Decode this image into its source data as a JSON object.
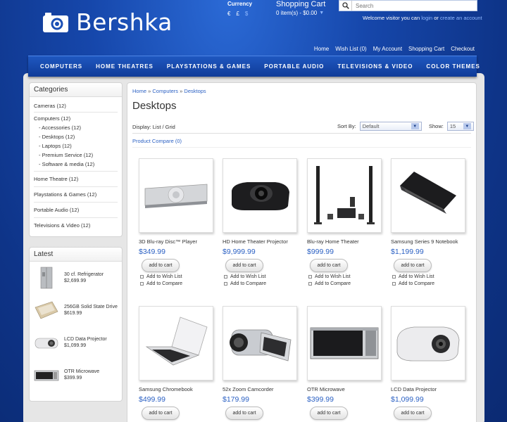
{
  "header": {
    "logo_text": "Bershka",
    "currency_label": "Currency",
    "currency_options": [
      "€",
      "£",
      "$"
    ],
    "cart_label": "Shopping Cart",
    "cart_value": "0 item(s) - $0.00",
    "search_placeholder": "Search",
    "welcome_text": "Welcome visitor you can",
    "login": "login",
    "or": "or",
    "create_account": "create an account",
    "links": [
      "Home",
      "Wish List (0)",
      "My Account",
      "Shopping Cart",
      "Checkout"
    ]
  },
  "nav": [
    "COMPUTERS",
    "HOME THEATRES",
    "PLAYSTATIONS & GAMES",
    "PORTABLE AUDIO",
    "TELEVISIONS & VIDEO",
    "COLOR THEMES"
  ],
  "categories": {
    "title": "Categories",
    "cameras": "Cameras (12)",
    "computers": "Computers (12)",
    "subs": [
      "- Accessories (12)",
      "- Desktops (12)",
      "- Laptops (12)",
      "- Premium Service (12)",
      "- Software & media (12)"
    ],
    "home_theatre": "Home Theatre (12)",
    "playstations": "Playstations & Games (12)",
    "portable": "Portable Audio (12)",
    "television": "Televisions & Video (12)"
  },
  "latest": {
    "title": "Latest",
    "items": [
      {
        "name": "30 cf. Refrigerator",
        "price": "$2,699.99"
      },
      {
        "name": "256GB Solid State Drive",
        "price": "$619.99"
      },
      {
        "name": "LCD Data Projector",
        "price": "$1,099.99"
      },
      {
        "name": "OTR Microwave",
        "price": "$399.99"
      }
    ]
  },
  "content": {
    "breadcrumb": [
      "Home",
      "Computers",
      "Desktops"
    ],
    "breadcrumb_sep": "»",
    "title": "Desktops",
    "display": "Display: List / Grid",
    "sort_label": "Sort By:",
    "sort_value": "Default",
    "show_label": "Show:",
    "show_value": "15",
    "compare": "Product Compare (0)",
    "add_to_cart": "add to cart",
    "wish": "Add to Wish List",
    "compare_item": "Add to Compare",
    "products": [
      {
        "name": "3D Blu-ray Disc™ Player",
        "price": "$349.99",
        "icon": "bluray-player-icon"
      },
      {
        "name": "HD Home Theater Projector",
        "price": "$9,999.99",
        "icon": "projector-icon"
      },
      {
        "name": "Blu-ray Home Theater",
        "price": "$999.99",
        "icon": "speakers-icon"
      },
      {
        "name": "Samsung Series 9 Notebook",
        "price": "$1,199.99",
        "icon": "notebook-icon"
      },
      {
        "name": "Samsung Chromebook",
        "price": "$499.99",
        "icon": "chromebook-icon"
      },
      {
        "name": "52x Zoom Camcorder",
        "price": "$179.99",
        "icon": "camcorder-icon"
      },
      {
        "name": "OTR Microwave",
        "price": "$399.99",
        "icon": "microwave-icon"
      },
      {
        "name": "LCD Data Projector",
        "price": "$1,099.99",
        "icon": "projector-icon"
      }
    ]
  }
}
